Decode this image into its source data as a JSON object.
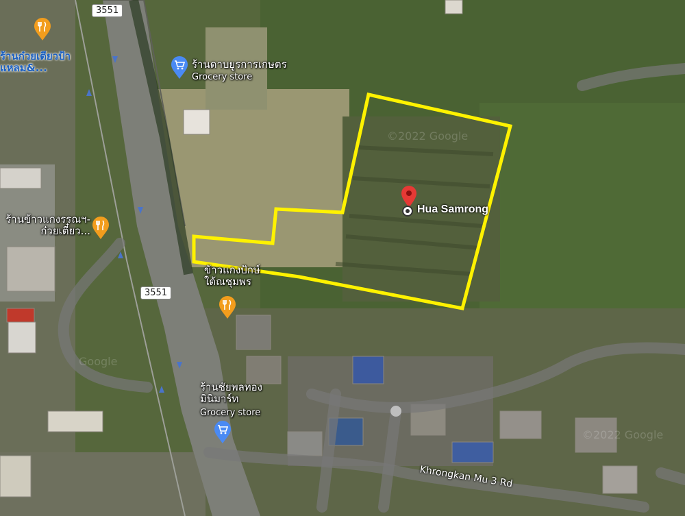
{
  "map": {
    "place_label": "Hua Samrong",
    "road_label": "Khrongkan Mu 3 Rd",
    "highway_shields": [
      "3551",
      "3551"
    ],
    "watermarks": [
      "©2022 Google",
      "Google",
      "©2022 Google"
    ],
    "pois": [
      {
        "name": "ร้านก๋วยเตี๋ยวป้าแหลม&...",
        "category": "",
        "icon": "restaurant-icon",
        "color": "#f29d1d"
      },
      {
        "name": "ร้านดาบยูรการเกษตร",
        "category": "Grocery store",
        "icon": "grocery-cart-icon",
        "color": "#4a8af4"
      },
      {
        "name": "ร้านข้าวแกงรรณฯ-ก๋วยเตี๋ยว...",
        "category": "",
        "icon": "restaurant-icon",
        "color": "#f29d1d"
      },
      {
        "name": "ข้าวแกงปักษ์ใต้ณชุมพร",
        "category": "",
        "icon": "restaurant-icon",
        "color": "#f29d1d"
      },
      {
        "name": "ร้านชัยพลทองมินิมาร์ท",
        "category": "Grocery store",
        "icon": "grocery-cart-icon",
        "color": "#4a8af4"
      }
    ],
    "boundary_color": "#fff200",
    "marker_color": "#e53935"
  }
}
